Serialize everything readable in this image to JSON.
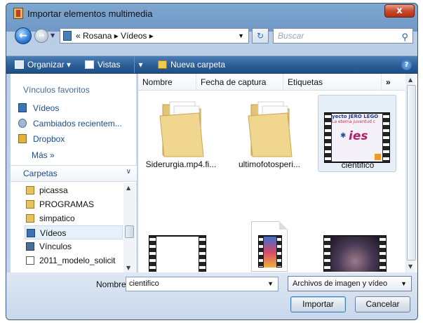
{
  "window": {
    "title": "Importar elementos multimedia",
    "close_label": "x"
  },
  "address": {
    "crumbs": "« Rosana ▸ Vídeos ▸",
    "search_placeholder": "Buscar"
  },
  "toolbar": {
    "organize": "Organizar",
    "views": "Vistas",
    "new_folder": "Nueva carpeta",
    "help": "?"
  },
  "sidebar": {
    "favorites_header": "Vínculos favoritos",
    "favorites": [
      {
        "label": "Vídeos",
        "icon": "videos-folder-icon"
      },
      {
        "label": "Cambiados recientem...",
        "icon": "recent-icon"
      },
      {
        "label": "Dropbox",
        "icon": "dropbox-icon"
      }
    ],
    "more": "Más »",
    "folders_header": "Carpetas",
    "tree": [
      {
        "label": "picassa",
        "icon": "folder-icon"
      },
      {
        "label": "PROGRAMAS",
        "icon": "folder-icon"
      },
      {
        "label": "simpatico",
        "icon": "folder-icon"
      },
      {
        "label": "Vídeos",
        "icon": "videos-folder-icon",
        "selected": true
      },
      {
        "label": "Vínculos",
        "icon": "folder-icon"
      },
      {
        "label": "2011_modelo_solicit",
        "icon": "document-icon"
      }
    ]
  },
  "columns": [
    "Nombre",
    "Fecha de captura",
    "Etiquetas",
    "»"
  ],
  "files": [
    {
      "name": "Siderurgia.mp4.fi...",
      "type": "folder"
    },
    {
      "name": "ultimofotosperi...",
      "type": "folder"
    },
    {
      "name": "cientifico",
      "type": "video",
      "thumb_text_1": "yecto JERO LEGO",
      "thumb_text_2": "La eterna juventud c",
      "thumb_text_3": "ies",
      "selected": true
    },
    {
      "name": "",
      "type": "video-blank"
    },
    {
      "name": "",
      "type": "video-doc"
    },
    {
      "name": "",
      "type": "video-dark"
    }
  ],
  "bottom": {
    "name_label": "Nombre:",
    "name_value": "cientifico",
    "filter_value": "Archivos de imagen y vídeo",
    "import_label": "Importar",
    "cancel_label": "Cancelar"
  },
  "colors": {
    "toolbar": "#2c5e96",
    "link": "#1d4c8a",
    "selection": "#cfe3f7"
  }
}
